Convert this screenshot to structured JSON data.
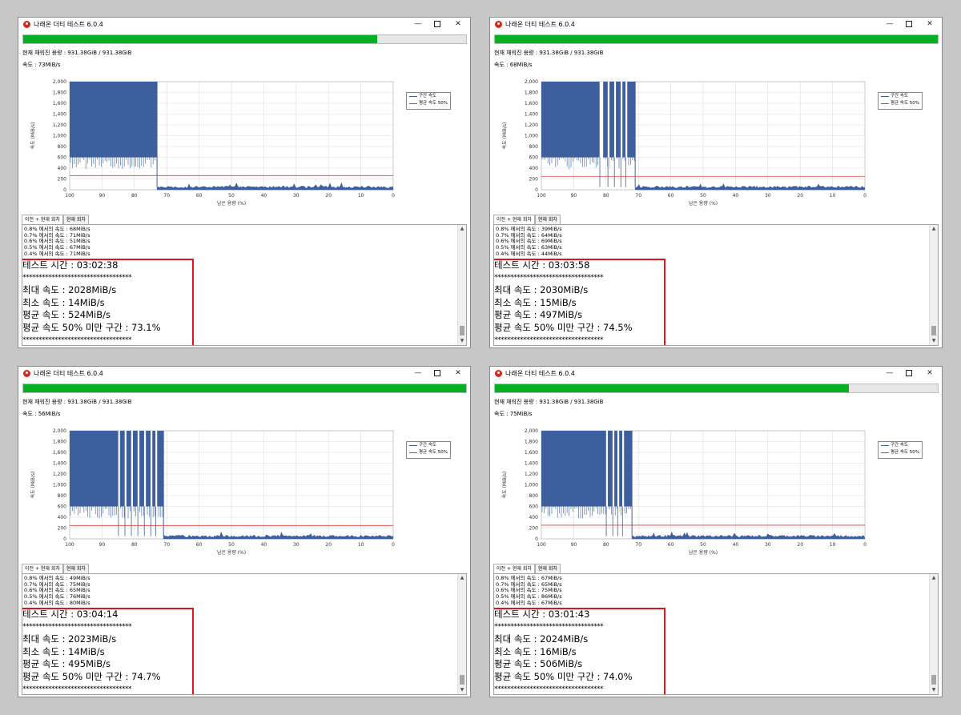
{
  "windows": [
    {
      "title": "나래온 더티 테스트 6.0.4",
      "progress": 0.8,
      "capacity_text": "현재 채워진 용량 : 931.38GiB / 931.38GiB",
      "speed_text": "속도 : 73MiB/s",
      "tabs": [
        "이전 + 현재 회차",
        "현재 회차"
      ],
      "log_lines": [
        "0.8% 에서의 속도 : 68MiB/s",
        "0.7% 에서의 속도 : 71MiB/s",
        "0.6% 에서의 속도 : 51MiB/s",
        "0.5% 에서의 속도 : 67MiB/s",
        "0.4% 에서의 속도 : 71MiB/s"
      ],
      "result": {
        "test_time": "테스트 시간 : 03:02:38",
        "stars": "**********************************",
        "max_speed": "최대 속도 : 2028MiB/s",
        "min_speed": "최소 속도 : 14MiB/s",
        "avg_speed": "평균 속도 : 524MiB/s",
        "below_half": "평균 속도 50% 미만 구간 : 73.1%"
      },
      "chart_data": {
        "type": "area",
        "ylabel": "속도 (MiB/s)",
        "xlabel": "남은 용량 (%)",
        "x_ticks": [
          100,
          90,
          80,
          70,
          60,
          50,
          40,
          30,
          20,
          10,
          0
        ],
        "y_ticks": [
          0,
          200,
          400,
          600,
          800,
          1000,
          1200,
          1400,
          1600,
          1800,
          2000
        ],
        "xlim": [
          100,
          0
        ],
        "ylim": [
          0,
          2000
        ],
        "legend": [
          "구간 속도",
          "평균 속도 50%"
        ],
        "legend_position": "right",
        "avg_half_line": 262,
        "dense_region": [
          100,
          73
        ],
        "dense_low": 600,
        "dense_high": 2000,
        "dips": [],
        "tail_level": 50
      }
    },
    {
      "title": "나래온 더티 테스트 6.0.4",
      "progress": 1.0,
      "capacity_text": "현재 채워진 용량 : 931.38GiB / 931.38GiB",
      "speed_text": "속도 : 68MiB/s",
      "tabs": [
        "이전 + 현재 회차",
        "현재 회차"
      ],
      "log_lines": [
        "0.8% 에서의 속도 : 39MiB/s",
        "0.7% 에서의 속도 : 64MiB/s",
        "0.6% 에서의 속도 : 69MiB/s",
        "0.5% 에서의 속도 : 63MiB/s",
        "0.4% 에서의 속도 : 44MiB/s"
      ],
      "result": {
        "test_time": "테스트 시간 : 03:03:58",
        "stars": "**********************************",
        "max_speed": "최대 속도 : 2030MiB/s",
        "min_speed": "최소 속도 : 15MiB/s",
        "avg_speed": "평균 속도 : 497MiB/s",
        "below_half": "평균 속도 50% 미만 구간 : 74.5%"
      },
      "chart_data": {
        "type": "area",
        "ylabel": "속도 (MiB/s)",
        "xlabel": "남은 용량 (%)",
        "x_ticks": [
          100,
          90,
          80,
          70,
          60,
          50,
          40,
          30,
          20,
          10,
          0
        ],
        "y_ticks": [
          0,
          200,
          400,
          600,
          800,
          1000,
          1200,
          1400,
          1600,
          1800,
          2000
        ],
        "xlim": [
          100,
          0
        ],
        "ylim": [
          0,
          2000
        ],
        "legend": [
          "구간 속도",
          "평균 속도 50%"
        ],
        "legend_position": "right",
        "avg_half_line": 248,
        "dense_region": [
          100,
          71
        ],
        "dense_low": 600,
        "dense_high": 2000,
        "dips": [
          [
            82,
            80
          ],
          [
            79.5,
            78.5
          ],
          [
            77.5,
            76.5
          ],
          [
            75.5,
            74.5
          ],
          [
            74,
            73
          ]
        ],
        "tail_level": 50
      }
    },
    {
      "title": "나래온 더티 테스트 6.0.4",
      "progress": 1.0,
      "capacity_text": "현재 채워진 용량 : 931.38GiB / 931.38GiB",
      "speed_text": "속도 : 56MiB/s",
      "tabs": [
        "이전 + 현재 회차",
        "현재 회차"
      ],
      "log_lines": [
        "0.8% 에서의 속도 : 49MiB/s",
        "0.7% 에서의 속도 : 75MiB/s",
        "0.6% 에서의 속도 : 65MiB/s",
        "0.5% 에서의 속도 : 76MiB/s",
        "0.4% 에서의 속도 : 80MiB/s"
      ],
      "result": {
        "test_time": "테스트 시간 : 03:04:14",
        "stars": "**********************************",
        "max_speed": "최대 속도 : 2023MiB/s",
        "min_speed": "최소 속도 : 14MiB/s",
        "avg_speed": "평균 속도 : 495MiB/s",
        "below_half": "평균 속도 50% 미만 구간 : 74.7%"
      },
      "chart_data": {
        "type": "area",
        "ylabel": "속도 (MiB/s)",
        "xlabel": "남은 용량 (%)",
        "x_ticks": [
          100,
          90,
          80,
          70,
          60,
          50,
          40,
          30,
          20,
          10,
          0
        ],
        "y_ticks": [
          0,
          200,
          400,
          600,
          800,
          1000,
          1200,
          1400,
          1600,
          1800,
          2000
        ],
        "xlim": [
          100,
          0
        ],
        "ylim": [
          0,
          2000
        ],
        "legend": [
          "구간 속도",
          "평균 속도 50%"
        ],
        "legend_position": "right",
        "avg_half_line": 247,
        "dense_region": [
          100,
          71
        ],
        "dense_low": 600,
        "dense_high": 2000,
        "dips": [
          [
            85,
            84
          ],
          [
            83,
            82
          ],
          [
            81,
            80
          ],
          [
            79,
            78
          ],
          [
            77,
            76
          ],
          [
            75,
            74
          ],
          [
            73.5,
            72.5
          ]
        ],
        "tail_level": 50
      }
    },
    {
      "title": "나래온 더티 테스트 6.0.4",
      "progress": 0.8,
      "capacity_text": "현재 채워진 용량 : 931.38GiB / 931.38GiB",
      "speed_text": "속도 : 75MiB/s",
      "tabs": [
        "이전 + 현재 회차",
        "현재 회차"
      ],
      "log_lines": [
        "0.8% 에서의 속도 : 67MiB/s",
        "0.7% 에서의 속도 : 65MiB/s",
        "0.6% 에서의 속도 : 75MiB/s",
        "0.5% 에서의 속도 : 86MiB/s",
        "0.4% 에서의 속도 : 67MiB/s"
      ],
      "result": {
        "test_time": "테스트 시간 : 03:01:43",
        "stars": "**********************************",
        "max_speed": "최대 속도 : 2024MiB/s",
        "min_speed": "최소 속도 : 16MiB/s",
        "avg_speed": "평균 속도 : 506MiB/s",
        "below_half": "평균 속도 50% 미만 구간 : 74.0%"
      },
      "chart_data": {
        "type": "area",
        "ylabel": "속도 (MiB/s)",
        "xlabel": "남은 용량 (%)",
        "x_ticks": [
          100,
          90,
          80,
          70,
          60,
          50,
          40,
          30,
          20,
          10,
          0
        ],
        "y_ticks": [
          0,
          200,
          400,
          600,
          800,
          1000,
          1200,
          1400,
          1600,
          1800,
          2000
        ],
        "xlim": [
          100,
          0
        ],
        "ylim": [
          0,
          2000
        ],
        "legend": [
          "구간 속도",
          "평균 속도 50%"
        ],
        "legend_position": "right",
        "avg_half_line": 253,
        "dense_region": [
          100,
          72
        ],
        "dense_low": 600,
        "dense_high": 2000,
        "dips": [
          [
            80,
            79
          ],
          [
            78,
            77
          ],
          [
            76.5,
            75.5
          ],
          [
            75,
            74
          ]
        ],
        "tail_level": 50
      }
    }
  ]
}
